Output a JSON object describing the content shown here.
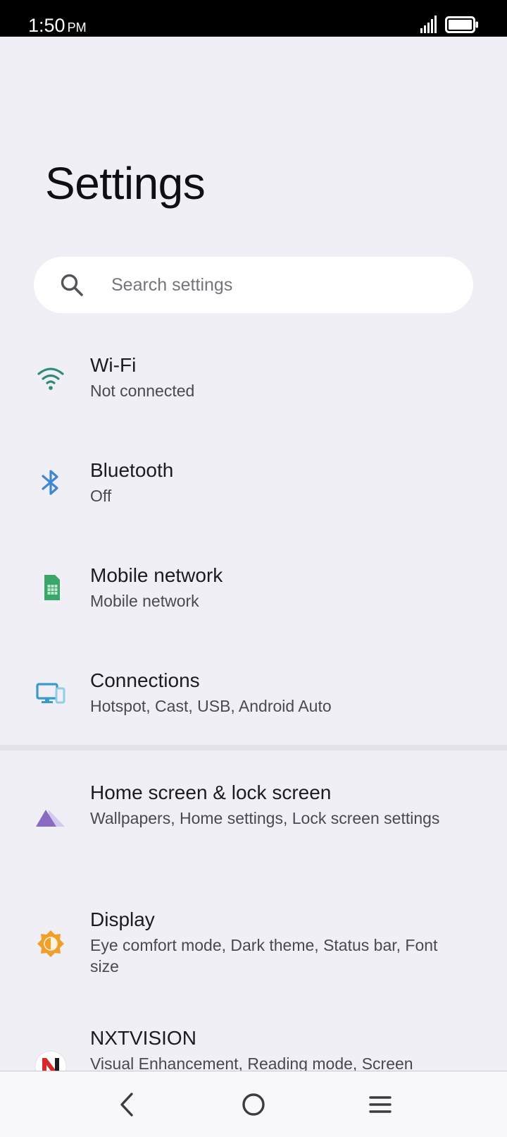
{
  "status_bar": {
    "time": "1:50",
    "ampm": "PM"
  },
  "header": {
    "title": "Settings"
  },
  "search": {
    "placeholder": "Search settings"
  },
  "items": [
    {
      "title": "Wi-Fi",
      "subtitle": "Not connected",
      "icon": "wifi-icon",
      "color": "#2e8b7a"
    },
    {
      "title": "Bluetooth",
      "subtitle": "Off",
      "icon": "bluetooth-icon",
      "color": "#3f87d0"
    },
    {
      "title": "Mobile network",
      "subtitle": "Mobile network",
      "icon": "sim-card-icon",
      "color": "#3aa76a"
    },
    {
      "title": "Connections",
      "subtitle": "Hotspot, Cast, USB, Android Auto",
      "icon": "devices-icon",
      "color": "#3a9bc8"
    },
    {
      "title": "Home screen & lock screen",
      "subtitle": "Wallpapers, Home settings, Lock screen settings",
      "icon": "wallpaper-icon",
      "color": "#8a6bc2"
    },
    {
      "title": "Display",
      "subtitle": "Eye comfort mode, Dark theme, Status bar, Font size",
      "icon": "brightness-icon",
      "color": "#f0a02a"
    },
    {
      "title": "NXTVISION",
      "subtitle": "Visual Enhancement, Reading mode, Screen",
      "icon": "nxtvision-icon",
      "color": "#d62a2a"
    }
  ]
}
